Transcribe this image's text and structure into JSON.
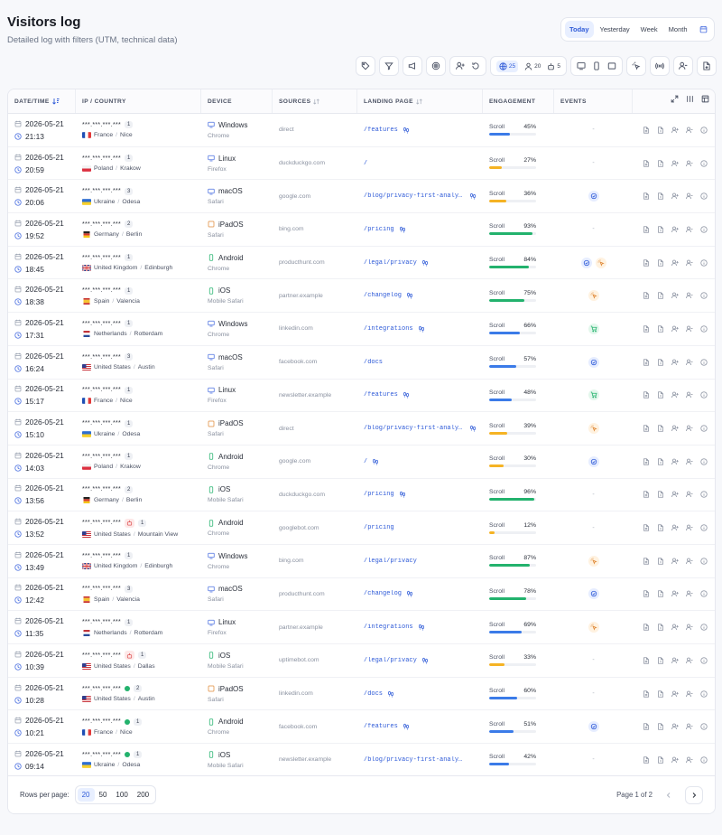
{
  "header": {
    "title": "Visitors log",
    "subtitle": "Detailed log with filters (UTM, technical data)"
  },
  "range": {
    "options": [
      "Today",
      "Yesterday",
      "Week",
      "Month"
    ],
    "active": "Today"
  },
  "toolbar": {
    "globe_count": "25",
    "users_count": "20",
    "bots_count": "5"
  },
  "columns": [
    "DATE/TIME",
    "IP / COUNTRY",
    "DEVICE",
    "SOURCES",
    "LANDING PAGE",
    "ENGAGEMENT",
    "EVENTS"
  ],
  "scroll_label": "Scroll",
  "rows": [
    {
      "date": "2026-05-21",
      "time": "21:13",
      "ip": "***.***.***.***",
      "count": "1",
      "flag": "fr",
      "country": "France",
      "city": "Nice",
      "device": "Windows",
      "dtype": "desktop",
      "browser": "Chrome",
      "source": "direct",
      "landing": "/features",
      "foot": true,
      "scroll": 45,
      "scroll_label": "45%",
      "events": [],
      "bot": false,
      "online": false
    },
    {
      "date": "2026-05-21",
      "time": "20:59",
      "ip": "***.***.***.***",
      "count": "1",
      "flag": "pl",
      "country": "Poland",
      "city": "Krakow",
      "device": "Linux",
      "dtype": "desktop",
      "browser": "Firefox",
      "source": "duckduckgo.com",
      "landing": "/",
      "foot": false,
      "scroll": 27,
      "scroll_label": "27%",
      "events": [],
      "bot": false,
      "online": false
    },
    {
      "date": "2026-05-21",
      "time": "20:06",
      "ip": "***.***.***.***",
      "count": "3",
      "flag": "ua",
      "country": "Ukraine",
      "city": "Odesa",
      "device": "macOS",
      "dtype": "desktop",
      "browser": "Safari",
      "source": "google.com",
      "landing": "/blog/privacy-first-analytics",
      "foot": true,
      "scroll": 36,
      "scroll_label": "36%",
      "events": [
        "goal"
      ],
      "bot": false,
      "online": false
    },
    {
      "date": "2026-05-21",
      "time": "19:52",
      "ip": "***.***.***.***",
      "count": "2",
      "flag": "de",
      "country": "Germany",
      "city": "Berlin",
      "device": "iPadOS",
      "dtype": "tablet",
      "browser": "Safari",
      "source": "bing.com",
      "landing": "/pricing",
      "foot": true,
      "scroll": 93,
      "scroll_label": "93%",
      "events": [],
      "bot": false,
      "online": false
    },
    {
      "date": "2026-05-21",
      "time": "18:45",
      "ip": "***.***.***.***",
      "count": "1",
      "flag": "gb",
      "country": "United Kingdom",
      "city": "Edinburgh",
      "device": "Android",
      "dtype": "mobile",
      "browser": "Chrome",
      "source": "producthunt.com",
      "landing": "/legal/privacy",
      "foot": true,
      "scroll": 84,
      "scroll_label": "84%",
      "events": [
        "goal",
        "spark"
      ],
      "bot": false,
      "online": false
    },
    {
      "date": "2026-05-21",
      "time": "18:38",
      "ip": "***.***.***.***",
      "count": "1",
      "flag": "es",
      "country": "Spain",
      "city": "Valencia",
      "device": "iOS",
      "dtype": "mobile",
      "browser": "Mobile Safari",
      "source": "partner.example",
      "landing": "/changelog",
      "foot": true,
      "scroll": 75,
      "scroll_label": "75%",
      "events": [
        "spark"
      ],
      "bot": false,
      "online": false
    },
    {
      "date": "2026-05-21",
      "time": "17:31",
      "ip": "***.***.***.***",
      "count": "1",
      "flag": "nl",
      "country": "Netherlands",
      "city": "Rotterdam",
      "device": "Windows",
      "dtype": "desktop",
      "browser": "Chrome",
      "source": "linkedin.com",
      "landing": "/integrations",
      "foot": true,
      "scroll": 66,
      "scroll_label": "66%",
      "events": [
        "cart"
      ],
      "bot": false,
      "online": false
    },
    {
      "date": "2026-05-21",
      "time": "16:24",
      "ip": "***.***.***.***",
      "count": "3",
      "flag": "us",
      "country": "United States",
      "city": "Austin",
      "device": "macOS",
      "dtype": "desktop",
      "browser": "Safari",
      "source": "facebook.com",
      "landing": "/docs",
      "foot": false,
      "scroll": 57,
      "scroll_label": "57%",
      "events": [
        "goal"
      ],
      "bot": false,
      "online": false
    },
    {
      "date": "2026-05-21",
      "time": "15:17",
      "ip": "***.***.***.***",
      "count": "1",
      "flag": "fr",
      "country": "France",
      "city": "Nice",
      "device": "Linux",
      "dtype": "desktop",
      "browser": "Firefox",
      "source": "newsletter.example",
      "landing": "/features",
      "foot": true,
      "scroll": 48,
      "scroll_label": "48%",
      "events": [
        "cart"
      ],
      "bot": false,
      "online": false
    },
    {
      "date": "2026-05-21",
      "time": "15:10",
      "ip": "***.***.***.***",
      "count": "1",
      "flag": "ua",
      "country": "Ukraine",
      "city": "Odesa",
      "device": "iPadOS",
      "dtype": "tablet",
      "browser": "Safari",
      "source": "direct",
      "landing": "/blog/privacy-first-analytics",
      "foot": true,
      "scroll": 39,
      "scroll_label": "39%",
      "events": [
        "spark"
      ],
      "bot": false,
      "online": false
    },
    {
      "date": "2026-05-21",
      "time": "14:03",
      "ip": "***.***.***.***",
      "count": "1",
      "flag": "pl",
      "country": "Poland",
      "city": "Krakow",
      "device": "Android",
      "dtype": "mobile",
      "browser": "Chrome",
      "source": "google.com",
      "landing": "/",
      "foot": true,
      "scroll": 30,
      "scroll_label": "30%",
      "events": [
        "goal"
      ],
      "bot": false,
      "online": false
    },
    {
      "date": "2026-05-21",
      "time": "13:56",
      "ip": "***.***.***.***",
      "count": "2",
      "flag": "de",
      "country": "Germany",
      "city": "Berlin",
      "device": "iOS",
      "dtype": "mobile",
      "browser": "Mobile Safari",
      "source": "duckduckgo.com",
      "landing": "/pricing",
      "foot": true,
      "scroll": 96,
      "scroll_label": "96%",
      "events": [],
      "bot": false,
      "online": false
    },
    {
      "date": "2026-05-21",
      "time": "13:52",
      "ip": "***.***.***.***",
      "count": "1",
      "flag": "us",
      "country": "United States",
      "city": "Mountain View",
      "device": "Android",
      "dtype": "mobile",
      "browser": "Chrome",
      "source": "googlebot.com",
      "landing": "/pricing",
      "foot": false,
      "scroll": 12,
      "scroll_label": "12%",
      "events": [],
      "bot": true,
      "online": false
    },
    {
      "date": "2026-05-21",
      "time": "13:49",
      "ip": "***.***.***.***",
      "count": "1",
      "flag": "gb",
      "country": "United Kingdom",
      "city": "Edinburgh",
      "device": "Windows",
      "dtype": "desktop",
      "browser": "Chrome",
      "source": "bing.com",
      "landing": "/legal/privacy",
      "foot": false,
      "scroll": 87,
      "scroll_label": "87%",
      "events": [
        "spark"
      ],
      "bot": false,
      "online": false
    },
    {
      "date": "2026-05-21",
      "time": "12:42",
      "ip": "***.***.***.***",
      "count": "3",
      "flag": "es",
      "country": "Spain",
      "city": "Valencia",
      "device": "macOS",
      "dtype": "desktop",
      "browser": "Safari",
      "source": "producthunt.com",
      "landing": "/changelog",
      "foot": true,
      "scroll": 78,
      "scroll_label": "78%",
      "events": [
        "goal"
      ],
      "bot": false,
      "online": false
    },
    {
      "date": "2026-05-21",
      "time": "11:35",
      "ip": "***.***.***.***",
      "count": "1",
      "flag": "nl",
      "country": "Netherlands",
      "city": "Rotterdam",
      "device": "Linux",
      "dtype": "desktop",
      "browser": "Firefox",
      "source": "partner.example",
      "landing": "/integrations",
      "foot": true,
      "scroll": 69,
      "scroll_label": "69%",
      "events": [
        "spark"
      ],
      "bot": false,
      "online": false
    },
    {
      "date": "2026-05-21",
      "time": "10:39",
      "ip": "***.***.***.***",
      "count": "1",
      "flag": "us",
      "country": "United States",
      "city": "Dallas",
      "device": "iOS",
      "dtype": "mobile",
      "browser": "Mobile Safari",
      "source": "uptimebot.com",
      "landing": "/legal/privacy",
      "foot": true,
      "scroll": 33,
      "scroll_label": "33%",
      "events": [],
      "bot": true,
      "online": false
    },
    {
      "date": "2026-05-21",
      "time": "10:28",
      "ip": "***.***.***.***",
      "count": "2",
      "flag": "us",
      "country": "United States",
      "city": "Austin",
      "device": "iPadOS",
      "dtype": "tablet",
      "browser": "Safari",
      "source": "linkedin.com",
      "landing": "/docs",
      "foot": true,
      "scroll": 60,
      "scroll_label": "60%",
      "events": [],
      "bot": false,
      "online": true
    },
    {
      "date": "2026-05-21",
      "time": "10:21",
      "ip": "***.***.***.***",
      "count": "1",
      "flag": "fr",
      "country": "France",
      "city": "Nice",
      "device": "Android",
      "dtype": "mobile",
      "browser": "Chrome",
      "source": "facebook.com",
      "landing": "/features",
      "foot": true,
      "scroll": 51,
      "scroll_label": "51%",
      "events": [
        "goal"
      ],
      "bot": false,
      "online": true
    },
    {
      "date": "2026-05-21",
      "time": "09:14",
      "ip": "***.***.***.***",
      "count": "1",
      "flag": "ua",
      "country": "Ukraine",
      "city": "Odesa",
      "device": "iOS",
      "dtype": "mobile",
      "browser": "Mobile Safari",
      "source": "newsletter.example",
      "landing": "/blog/privacy-first-analytics",
      "foot": false,
      "scroll": 42,
      "scroll_label": "42%",
      "events": [],
      "bot": false,
      "online": true
    }
  ],
  "footer": {
    "rows_per_page_label": "Rows per page:",
    "options": [
      "20",
      "50",
      "100",
      "200"
    ],
    "active": "20",
    "page_label": "Page 1 of 2"
  },
  "colors": {
    "accent": "#2f5bd8",
    "scroll_low": "#f5b324",
    "scroll_mid": "#3b7be8",
    "scroll_high": "#23b26d"
  }
}
